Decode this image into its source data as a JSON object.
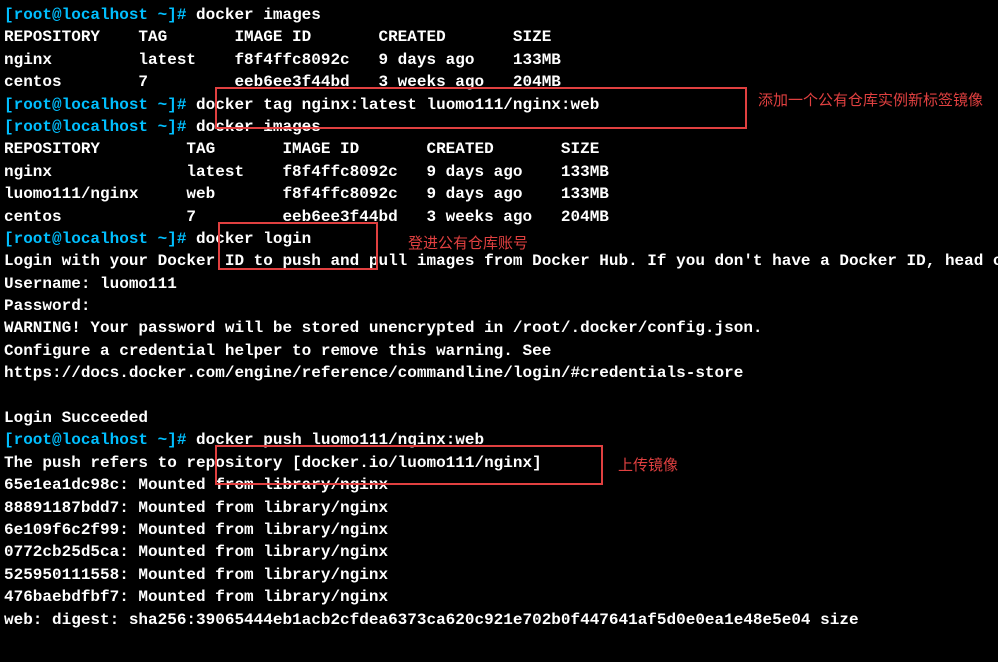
{
  "prompt": "[root@localhost ~]#",
  "commands": {
    "docker_images_1": "docker images",
    "docker_tag": "docker tag nginx:latest luomo111/nginx:web",
    "docker_images_2": "docker images",
    "docker_login": "docker login",
    "docker_push": "docker push luomo111/nginx:web"
  },
  "table1": {
    "header": "REPOSITORY    TAG       IMAGE ID       CREATED       SIZE",
    "rows": [
      "nginx         latest    f8f4ffc8092c   9 days ago    133MB",
      "centos        7         eeb6ee3f44bd   3 weeks ago   204MB"
    ]
  },
  "table2": {
    "header": "REPOSITORY         TAG       IMAGE ID       CREATED       SIZE",
    "rows": [
      "nginx              latest    f8f4ffc8092c   9 days ago    133MB",
      "luomo111/nginx     web       f8f4ffc8092c   9 days ago    133MB",
      "centos             7         eeb6ee3f44bd   3 weeks ago   204MB"
    ]
  },
  "login": {
    "info": "Login with your Docker ID to push and pull images from Docker Hub. If you don't have a Docker ID, head over to https://hub.docker.com to create one.",
    "username_label": "Username: ",
    "username_value": "luomo111",
    "password_label": "Password:",
    "warning1": "WARNING! Your password will be stored unencrypted in /root/.docker/config.json.",
    "warning2": "Configure a credential helper to remove this warning. See",
    "warning3": "https://docs.docker.com/engine/reference/commandline/login/#credentials-store",
    "success": "Login Succeeded"
  },
  "push": {
    "refers": "The push refers to repository [docker.io/luomo111/nginx]",
    "layers": [
      "65e1ea1dc98c: Mounted from library/nginx",
      "88891187bdd7: Mounted from library/nginx",
      "6e109f6c2f99: Mounted from library/nginx",
      "0772cb25d5ca: Mounted from library/nginx",
      "525950111558: Mounted from library/nginx",
      "476baebdfbf7: Mounted from library/nginx"
    ],
    "digest": "web: digest: sha256:39065444eb1acb2cfdea6373ca620c921e702b0f447641af5d0e0ea1e48e5e04 size"
  },
  "annotations": {
    "tag_label": "添加一个公有仓库实例新标签镜像",
    "login_label": "登进公有仓库账号",
    "push_label": "上传镜像"
  },
  "colors": {
    "prompt": "#00bfff",
    "text": "#ffffff",
    "bg": "#000000",
    "annotation": "#e04040"
  }
}
